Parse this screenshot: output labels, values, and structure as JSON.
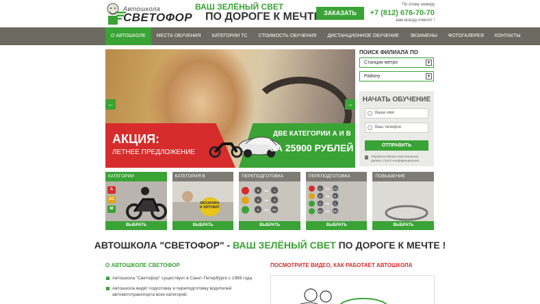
{
  "header": {
    "logo_top": "Автошкола",
    "logo_main": "СВЕТОФОР",
    "slogan_line1": "ВАШ ЗЕЛЁНЫЙ СВЕТ",
    "slogan_line2": "ПО ДОРОГЕ К МЕЧТЕ",
    "call_button": "ЗАКАЗАТЬ ЗВОНОК",
    "phone_caption": "По этому номеру",
    "phone": "+7 (812) 676-70-70",
    "phone_note": "вам всегда ответят !"
  },
  "nav": {
    "items": [
      {
        "label": "О АВТОШКОЛЕ",
        "active": true
      },
      {
        "label": "МЕСТА ОБУЧЕНИЯ"
      },
      {
        "label": "КАТЕГОРИИ ТС"
      },
      {
        "label": "СТОИМОСТЬ ОБУЧЕНИЯ"
      },
      {
        "label": "ДИСТАНЦИОННОЕ ОБУЧЕНИЕ"
      },
      {
        "label": "ЭКЗАМЕНЫ"
      },
      {
        "label": "ФОТОГАЛЕРЕЯ"
      },
      {
        "label": "КОНТАКТЫ"
      }
    ]
  },
  "slider": {
    "arrow_left": "←",
    "arrow_right": "→",
    "promo_title": "АКЦИЯ:",
    "promo_sub": "ЛЕТНЕЕ ПРЕДЛОЖЕНИЕ",
    "promo_categories": "ДВЕ КАТЕГОРИИ А И В",
    "promo_price": "ЗА 25900 РУБЛЕЙ"
  },
  "sidebar": {
    "search_title": "ПОИСК ФИЛИАЛА ПО",
    "select_metro": "Станции метро",
    "select_district": "Району",
    "form_title": "НАЧАТЬ ОБУЧЕНИЕ",
    "name_placeholder": "Ваше имя",
    "phone_placeholder": "Ваш телефон",
    "submit": "ОТПРАВИТЬ",
    "privacy": "Обработка Ваших персональных данных строго конфиденциальна."
  },
  "categories": [
    {
      "label": "КАТЕГОРИИ",
      "button": "ВЫБРАТЬ",
      "letters": [
        "A",
        "A1",
        "M"
      ]
    },
    {
      "label": "КАТЕГОРИЯ B",
      "button": "ВЫБРАТЬ",
      "badge": "МЕХАНИКА И АВТОМАТ"
    },
    {
      "label": "ПЕРЕПОДГОТОВКА",
      "button": "ВЫБРАТЬ",
      "marks": [
        "B",
        "B",
        "B"
      ],
      "targets": [
        "C",
        "D",
        "BE"
      ],
      "na": "НА"
    },
    {
      "label": "ПЕРЕПОДГОТОВКА",
      "button": "ВЫБРАТЬ",
      "marks": [
        "C",
        "C",
        "D",
        "BC"
      ],
      "targets": [
        "CE",
        "D",
        "C",
        "DE"
      ],
      "na": "НА"
    },
    {
      "label": "ПОВЫШЕНИЕ КВАЛИФИКАЦИИ",
      "button": "ВЫБРАТЬ"
    }
  ],
  "headline": {
    "part1": "АВТОШКОЛА \"СВЕТОФОР\" - ",
    "part2": "ВАШ ЗЕЛЁНЫЙ СВЕТ",
    "part3": " ПО ДОРОГЕ К МЕЧТЕ !"
  },
  "about": {
    "title": "О АВТОШКОЛЕ СВЕТОФОР",
    "items": [
      "Автошкола \"Светофор\" существует в Санкт-Петербурге с 1989 года",
      "Автошкола ведёт подготовку и переподготовку водителей автомототранспорта всех категорий."
    ]
  },
  "video": {
    "title": "ПОСМОТРИТЕ ВИДЕО, КАК РАБОТАЕТ АВТОШКОЛА"
  },
  "colors": {
    "green": "#3aa335",
    "red": "#d62c2c",
    "nav_bg": "#6a6a60"
  }
}
